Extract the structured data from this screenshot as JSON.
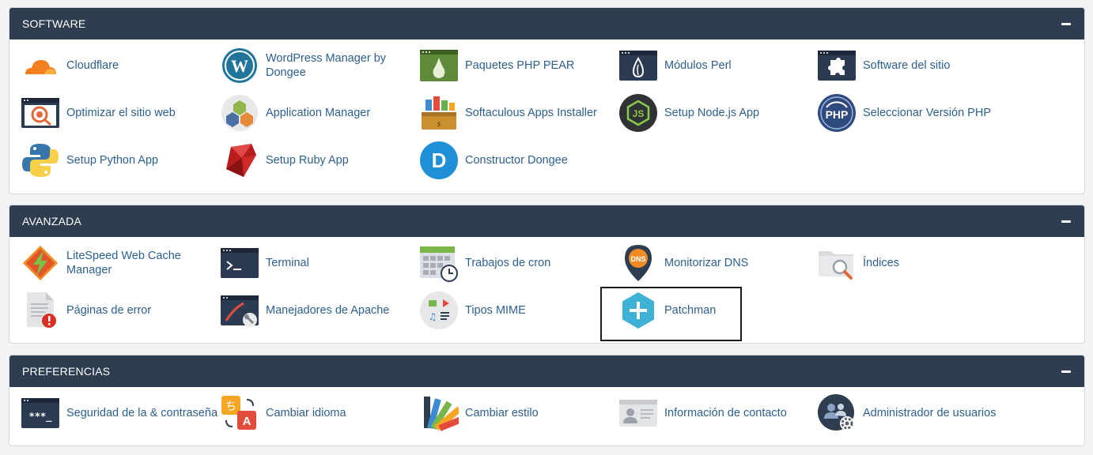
{
  "sections": {
    "software": {
      "title": "SOFTWARE",
      "items": [
        "Cloudflare",
        "WordPress Manager by Dongee",
        "Paquetes PHP PEAR",
        "Módulos Perl",
        "Software del sitio",
        "Optimizar el sitio web",
        "Application Manager",
        "Softaculous Apps Installer",
        "Setup Node.js App",
        "Seleccionar Versión PHP",
        "Setup Python App",
        "Setup Ruby App",
        "Constructor Dongee"
      ]
    },
    "avanzada": {
      "title": "AVANZADA",
      "items": [
        "LiteSpeed Web Cache Manager",
        "Terminal",
        "Trabajos de cron",
        "Monitorizar DNS",
        "Índices",
        "Páginas de error",
        "Manejadores de Apache",
        "Tipos MIME",
        "Patchman"
      ]
    },
    "preferencias": {
      "title": "PREFERENCIAS",
      "items": [
        "Seguridad de la & contraseña",
        "Cambiar idioma",
        "Cambiar estilo",
        "Información de contacto",
        "Administrador de usuarios"
      ]
    }
  },
  "icon_text": {
    "php": "PHP",
    "dns": "DNS",
    "node": "JS",
    "dongee": "D",
    "lang_a": "A",
    "lang_b": "ち",
    "password": "***_"
  },
  "colors": {
    "header_bg": "#2f3d50",
    "link": "#2d5f8f",
    "highlight_border": "#1a1a1a"
  }
}
